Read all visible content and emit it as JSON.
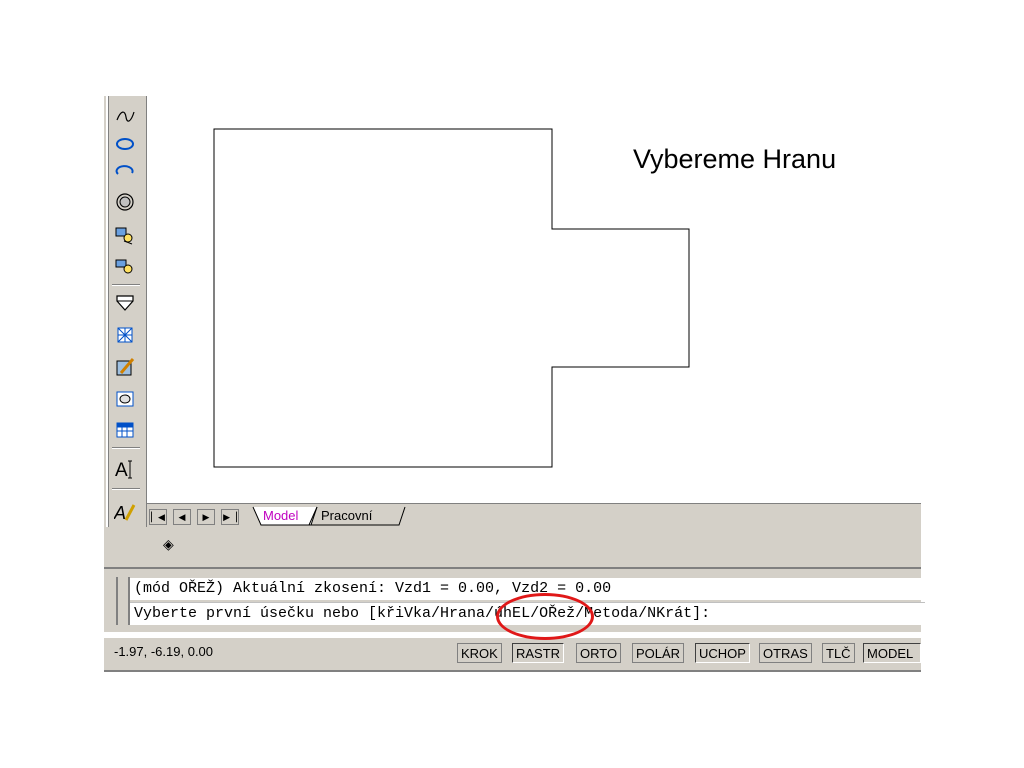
{
  "caption": "Vybereme Hranu",
  "toolbar": {
    "icons": [
      "spline-icon",
      "ellipse-icon",
      "ellipse-arc-icon",
      "donut-icon",
      "insert-block-icon",
      "make-block-icon",
      "point-icon",
      "hatch-icon",
      "gradient-icon",
      "region-icon",
      "table-icon",
      "multiline-text-icon",
      "text-edit-icon"
    ]
  },
  "tabs": {
    "nav_icons": [
      "first-tab-icon",
      "prev-tab-icon",
      "next-tab-icon",
      "last-tab-icon"
    ],
    "model": "Model",
    "layout": "Pracovní"
  },
  "command": {
    "line1": "(mód OŘEŽ) Aktuální zkosení: Vzd1 = 0.00, Vzd2 = 0.00",
    "line2": "Vyberte první úsečku nebo [křiVka/Hrana/úhEL/OŘež/Metoda/NKrát]:"
  },
  "status": {
    "coords": "-1.97, -6.19, 0.00",
    "buttons": [
      "KROK",
      "RASTR",
      "ORTO",
      "POLÁR",
      "UCHOP",
      "OTRAS",
      "TLČ",
      "MODEL"
    ],
    "pressed": [
      "RASTR",
      "UCHOP",
      "MODEL"
    ]
  },
  "highlight_color": "#e01818"
}
